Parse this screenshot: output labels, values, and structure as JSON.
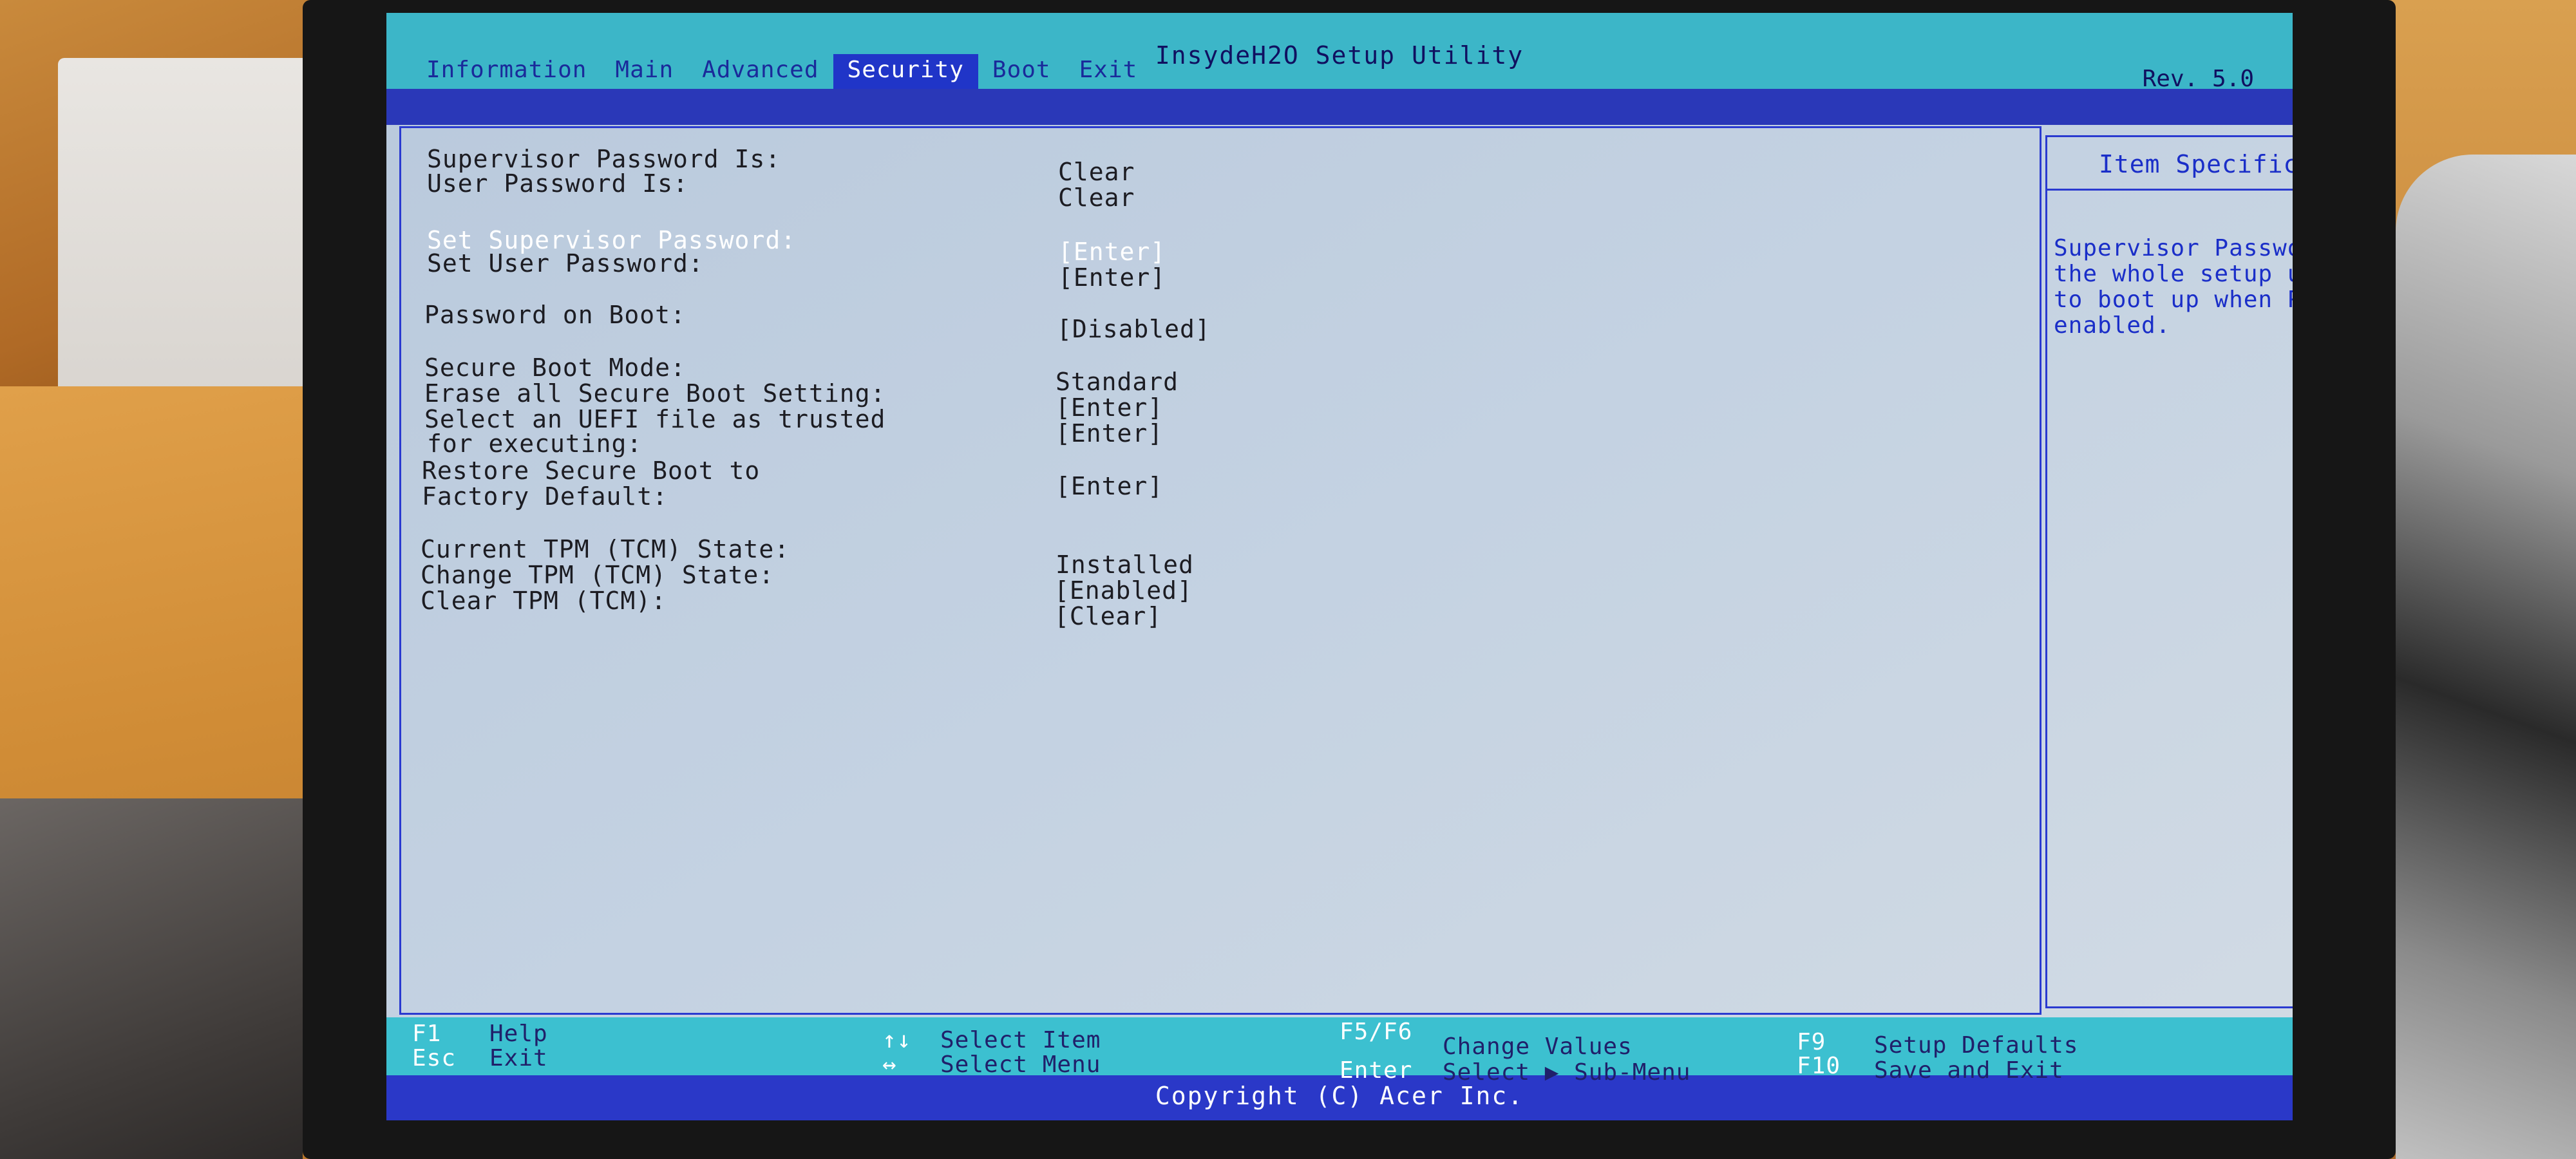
{
  "app": {
    "title": "InsydeH2O Setup Utility",
    "revision": "Rev. 5.0",
    "copyright": "Copyright (C) Acer Inc."
  },
  "tabs": [
    {
      "label": "Information",
      "active": false
    },
    {
      "label": "Main",
      "active": false
    },
    {
      "label": "Advanced",
      "active": false
    },
    {
      "label": "Security",
      "active": true
    },
    {
      "label": "Boot",
      "active": false
    },
    {
      "label": "Exit",
      "active": false
    }
  ],
  "settings": {
    "supervisor_password_is": {
      "label": "Supervisor Password Is:",
      "value": "Clear"
    },
    "user_password_is": {
      "label": "User Password Is:",
      "value": "Clear"
    },
    "set_supervisor_password": {
      "label": "Set Supervisor Password:",
      "value": "[Enter]"
    },
    "set_user_password": {
      "label": "Set User Password:",
      "value": "[Enter]"
    },
    "password_on_boot": {
      "label": "Password on Boot:",
      "value": "[Disabled]"
    },
    "secure_boot_mode": {
      "label": "Secure Boot Mode:",
      "value": "Standard"
    },
    "erase_secure_boot": {
      "label": "Erase all Secure Boot Setting:",
      "value": "[Enter]"
    },
    "select_uefi_file": {
      "label_line1": "Select an UEFI file as trusted",
      "label_line2": "for executing:",
      "value": "[Enter]"
    },
    "restore_secure_boot": {
      "label_line1": "Restore Secure Boot to",
      "label_line2": "Factory Default:",
      "value": "[Enter]"
    },
    "current_tpm_state": {
      "label": "Current TPM (TCM) State:",
      "value": "Installed"
    },
    "change_tpm_state": {
      "label": "Change TPM (TCM) State:",
      "value": "[Enabled]"
    },
    "clear_tpm": {
      "label": "Clear TPM (TCM):",
      "value": "[Clear]"
    }
  },
  "help": {
    "header": "Item Specific Help",
    "text": "Supervisor Password controls access to the whole setup utility. It can be used to boot up when Password on boot is enabled."
  },
  "footer": {
    "f1_key": "F1",
    "f1_desc": "Help",
    "esc_key": "Esc",
    "esc_desc": "Exit",
    "updown_key": "↑↓",
    "updown_desc": "Select Item",
    "leftright_key": "↔",
    "leftright_desc": "Select Menu",
    "f5f6_key": "F5/F6",
    "f5f6_desc": "Change Values",
    "enter_key": "Enter",
    "enter_desc": "Select ▶ Sub-Menu",
    "f9_key": "F9",
    "f9_desc": "Setup Defaults",
    "f10_key": "F10",
    "f10_desc": "Save and Exit"
  },
  "colors": {
    "screen_bg": "#c4d2e2",
    "title_bar": "#3cb6c8",
    "menu_bar": "#2a38b8",
    "active_tab": "#2035c8",
    "help_text": "#1a2ec8",
    "selected_text": "#ffffff"
  }
}
